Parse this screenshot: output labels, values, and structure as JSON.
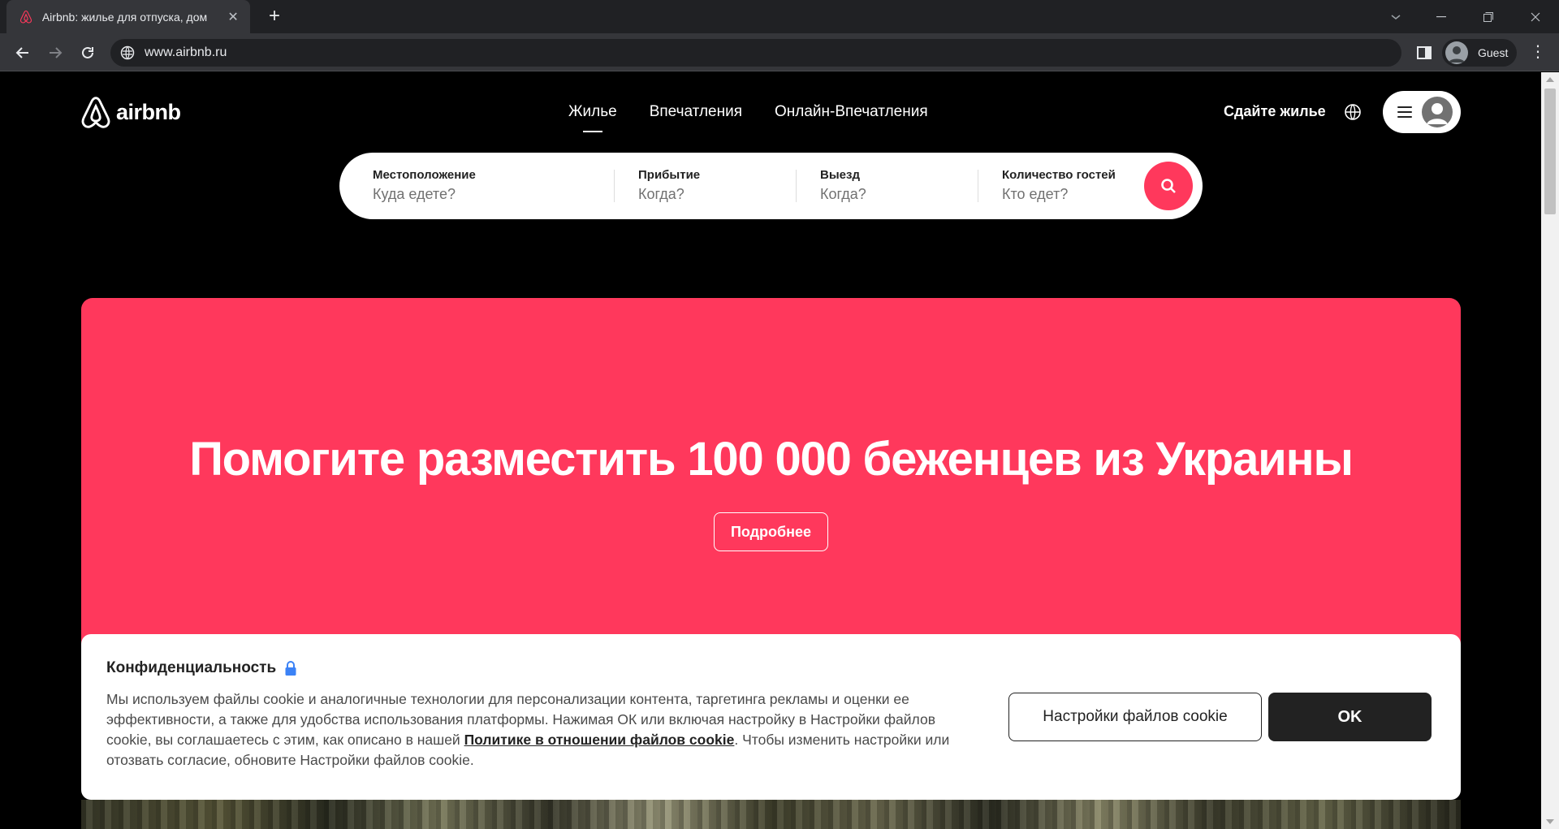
{
  "browser": {
    "tab_title": "Airbnb: жилье для отпуска, дом",
    "new_tab_symbol": "+",
    "close_symbol": "✕",
    "url": "www.airbnb.ru",
    "profile_label": "Guest",
    "menu_symbol": "⋮",
    "icons": [
      "airbnb-favicon-icon",
      "back-icon",
      "forward-icon",
      "reload-icon",
      "site-info-icon",
      "side-panel-icon",
      "profile-icon",
      "tab-search-icon",
      "minimize-icon",
      "restore-icon",
      "close-icon"
    ]
  },
  "header": {
    "logo_text": "airbnb",
    "nav": [
      {
        "label": "Жилье",
        "active": true
      },
      {
        "label": "Впечатления",
        "active": false
      },
      {
        "label": "Онлайн-Впечатления",
        "active": false
      }
    ],
    "host_link": "Сдайте жилье",
    "icons": [
      "globe-icon",
      "menu-icon",
      "user-avatar-icon"
    ]
  },
  "search": {
    "fields": [
      {
        "label": "Местоположение",
        "placeholder": "Куда едете?"
      },
      {
        "label": "Прибытие",
        "placeholder": "Когда?"
      },
      {
        "label": "Выезд",
        "placeholder": "Когда?"
      },
      {
        "label": "Количество гостей",
        "placeholder": "Кто едет?"
      }
    ],
    "button_icon": "search-icon"
  },
  "hero": {
    "title": "Помогите разместить 100 000 беженцев из Украины",
    "button_label": "Подробнее"
  },
  "cookie": {
    "title": "Конфиденциальность",
    "text_before": "Мы используем файлы cookie и аналогичные технологии для персонализации контента, таргетинга рекламы и оценки ее эффективности, а также для удобства использования платформы. Нажимая ОК или включая настройку в Настройки файлов cookie, вы соглашаетесь с этим, как описано в нашей ",
    "link_text": "Политике в отношении файлов cookie",
    "text_after": ". Чтобы изменить настройки или отозвать согласие, обновите Настройки файлов cookie.",
    "settings_button": "Настройки файлов cookie",
    "ok_button": "OK"
  },
  "colors": {
    "brand": "#ff385c",
    "chrome_dark": "#202124",
    "chrome_mid": "#35363a",
    "dark_button": "#222222"
  }
}
